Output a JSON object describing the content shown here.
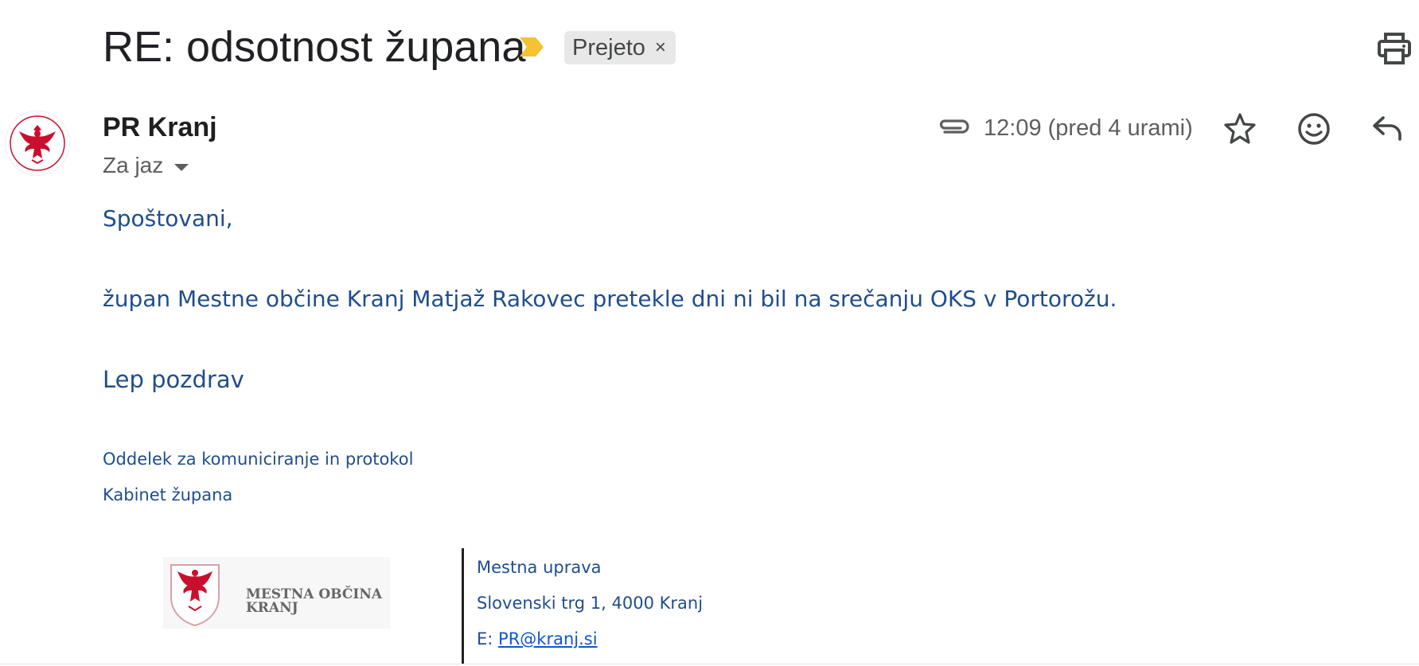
{
  "email": {
    "subject": "RE: odsotnost župana",
    "label": "Prejeto",
    "label_remove": "×",
    "sender_name": "PR Kranj",
    "recipient": "Za jaz",
    "time": "12:09 (pred 4 urami)",
    "body": {
      "greeting": "Spoštovani,",
      "paragraph": "župan Mestne občine Kranj Matjaž Rakovec pretekle dni ni bil na srečanju OKS v Portorožu.",
      "closing": "Lep pozdrav"
    },
    "signature": {
      "department": "Oddelek za komuniciranje in protokol",
      "cabinet": "Kabinet župana",
      "logo_text_line1": "MESTNA OBČINA",
      "logo_text_line2": "KRANJ",
      "address_line1": "Mestna uprava",
      "address_line2": "Slovenski trg 1, 4000 Kranj",
      "email_prefix": "E: ",
      "email": "PR@kranj.si"
    }
  },
  "icons": {
    "importance": "importance-marker-icon",
    "print": "print-icon",
    "avatar": "coat-of-arms-avatar",
    "attachment": "paperclip-icon",
    "star": "star-icon",
    "emoji": "emoji-icon",
    "reply": "reply-icon"
  },
  "colors": {
    "body_text": "#1f4e8c",
    "importance": "#f6c231",
    "label_chip_bg": "#e8e8e8",
    "crest_red": "#c8102e",
    "link": "#0b57d0"
  }
}
